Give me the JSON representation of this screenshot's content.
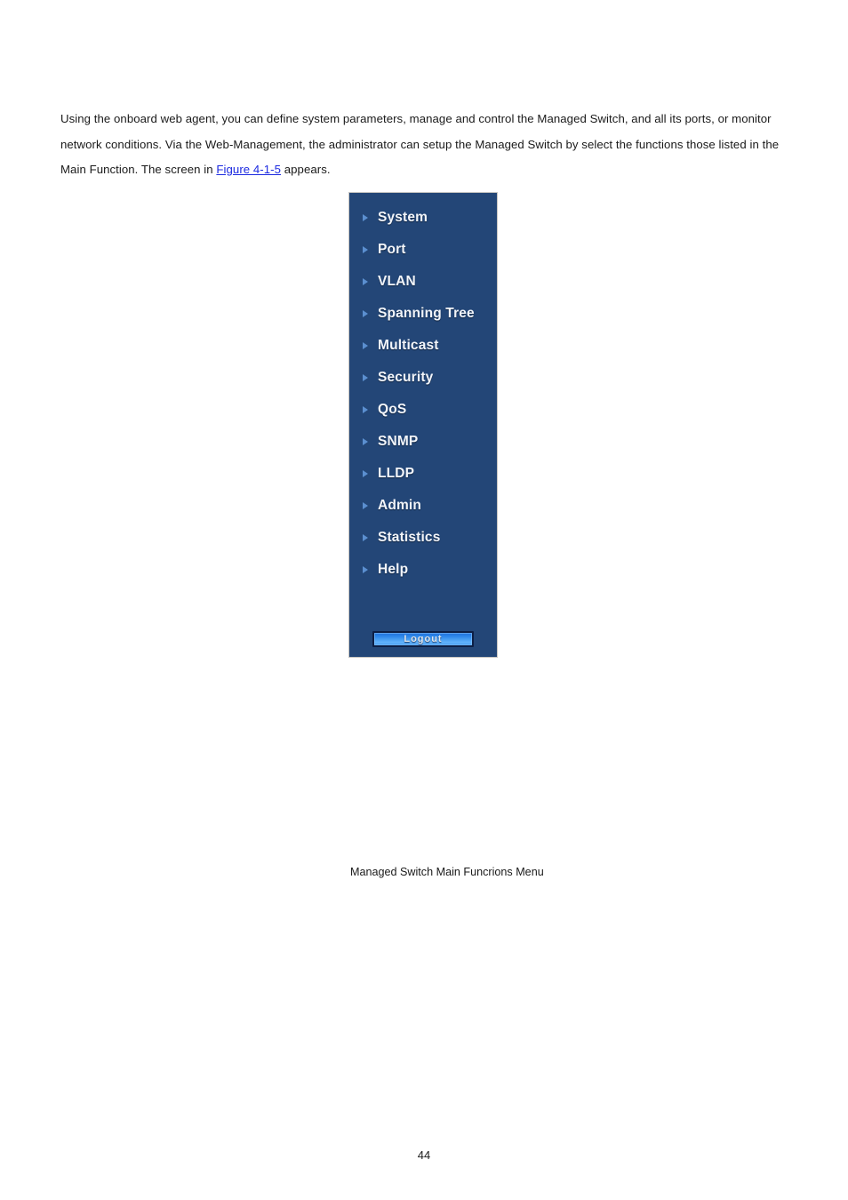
{
  "document": {
    "paragraph": {
      "before_link": "Using the onboard web agent, you can define system parameters, manage and control the Managed Switch, and all its ports, or monitor network conditions. Via the Web-Management, the administrator can setup the Managed Switch by select the functions those listed in the Main Function. The screen in ",
      "link_text": "Figure 4-1-5",
      "after_link": " appears."
    },
    "page_number": "44"
  },
  "figure": {
    "caption": "Managed Switch Main Funcrions Menu",
    "panel": {
      "background_color": "#234677",
      "border_color": "#c8c6c2",
      "arrow_color": "#5b8fd0",
      "label_color": "#f2f5fa"
    },
    "menu": {
      "items": [
        {
          "label": "System",
          "icon": "chevron-right-icon"
        },
        {
          "label": "Port",
          "icon": "chevron-right-icon"
        },
        {
          "label": "VLAN",
          "icon": "chevron-right-icon"
        },
        {
          "label": "Spanning Tree",
          "icon": "chevron-right-icon"
        },
        {
          "label": "Multicast",
          "icon": "chevron-right-icon"
        },
        {
          "label": "Security",
          "icon": "chevron-right-icon"
        },
        {
          "label": "QoS",
          "icon": "chevron-right-icon"
        },
        {
          "label": "SNMP",
          "icon": "chevron-right-icon"
        },
        {
          "label": "LLDP",
          "icon": "chevron-right-icon"
        },
        {
          "label": "Admin",
          "icon": "chevron-right-icon"
        },
        {
          "label": "Statistics",
          "icon": "chevron-right-icon"
        },
        {
          "label": "Help",
          "icon": "chevron-right-icon"
        }
      ]
    },
    "logout_button": {
      "label": "Logout",
      "accent_color": "#2d86ea",
      "border_color": "#0d1f45",
      "text_color": "#dfe6ee"
    }
  }
}
